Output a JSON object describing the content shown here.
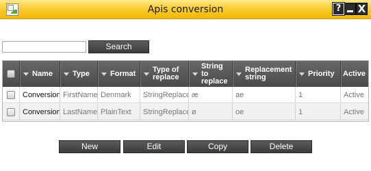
{
  "window": {
    "title": "Apis conversion",
    "controls": {
      "help": "?",
      "close": "X"
    }
  },
  "search": {
    "value": "",
    "placeholder": "",
    "button_label": "Search"
  },
  "grid": {
    "columns": [
      "Name",
      "Type",
      "Format",
      "Type of replace",
      "String to replace",
      "Replacement string",
      "Priority",
      "Active"
    ],
    "header_lines": {
      "type_of_replace": [
        "Type of",
        "replace"
      ],
      "string_to_replace": [
        "String",
        "to",
        "replace"
      ],
      "replacement_string": [
        "Replacement",
        "string"
      ]
    },
    "rows": [
      {
        "name": "Conversion",
        "type": "FirstName",
        "format": "Denmark",
        "type_of_replace": "StringReplace",
        "string_to_replace": "æ",
        "replacement_string": "ae",
        "priority": "1",
        "active": "Active"
      },
      {
        "name": "Conversion",
        "type": "LastName",
        "format": "PlainText",
        "type_of_replace": "StringReplace",
        "string_to_replace": "ø",
        "replacement_string": "oe",
        "priority": "1",
        "active": "Active"
      }
    ]
  },
  "actions": {
    "new": "New",
    "edit": "Edit",
    "copy": "Copy",
    "delete": "Delete"
  }
}
